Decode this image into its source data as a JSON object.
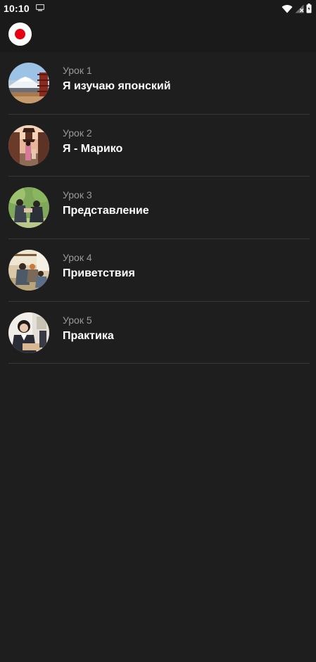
{
  "status_bar": {
    "time": "10:10",
    "icons": [
      "screenshot-icon",
      "wifi-icon",
      "signal-icon",
      "battery-icon"
    ]
  },
  "app_bar": {
    "logo_icon": "japan-flag-icon",
    "logo_color": "#e60012"
  },
  "lessons": [
    {
      "number": "Урок 1",
      "title": "Я изучаю японский",
      "thumbnail": "mount-fuji-pagoda"
    },
    {
      "number": "Урок 2",
      "title": "Я - Марико",
      "thumbnail": "kyoto-street-kimono"
    },
    {
      "number": "Урок 3",
      "title": "Представление",
      "thumbnail": "people-bowing-park"
    },
    {
      "number": "Урок 4",
      "title": "Приветствия",
      "thumbnail": "family-tatami-room"
    },
    {
      "number": "Урок 5",
      "title": "Практика",
      "thumbnail": "student-classroom"
    }
  ],
  "colors": {
    "background": "#1e1e1e",
    "app_bar": "#1a1a1a",
    "divider": "#383838",
    "subtitle": "#9a9a9a"
  }
}
